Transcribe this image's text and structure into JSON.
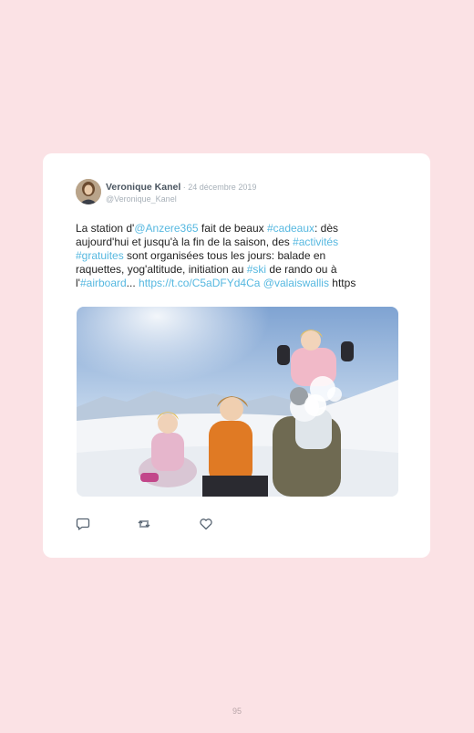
{
  "tweet": {
    "author_name": "Veronique Kanel",
    "separator": " · ",
    "date": "24 décembre 2019",
    "handle": "@Veronique_Kanel",
    "segments": [
      {
        "text": "La station d'",
        "link": false
      },
      {
        "text": "@Anzere365",
        "link": true
      },
      {
        "text": " fait de beaux ",
        "link": false
      },
      {
        "text": "#cadeaux",
        "link": true
      },
      {
        "text": ": dès aujourd'hui et jusqu'à la fin de la saison, des ",
        "link": false
      },
      {
        "text": "#activités",
        "link": true
      },
      {
        "text": " ",
        "link": false
      },
      {
        "text": "#gratuites",
        "link": true
      },
      {
        "text": " sont organisées tous les jours: balade en raquettes, yog'altitude, initiation au ",
        "link": false
      },
      {
        "text": "#ski",
        "link": true
      },
      {
        "text": " de rando ou à l'",
        "link": false
      },
      {
        "text": "#airboard",
        "link": true
      },
      {
        "text": "... ",
        "link": false
      },
      {
        "text": "https://t.co/C5aDFYd4Ca",
        "link": true
      },
      {
        "text": " ",
        "link": false
      },
      {
        "text": "@valaiswallis",
        "link": true
      },
      {
        "text": " https",
        "link": false
      }
    ],
    "actions": [
      {
        "name": "reply-icon"
      },
      {
        "name": "retweet-icon"
      },
      {
        "name": "like-icon"
      }
    ]
  },
  "page_number": "95",
  "colors": {
    "background": "#fbe2e5",
    "card": "#ffffff",
    "link": "#56b8e0",
    "name": "#4a5560",
    "muted": "#a7b0b8"
  }
}
